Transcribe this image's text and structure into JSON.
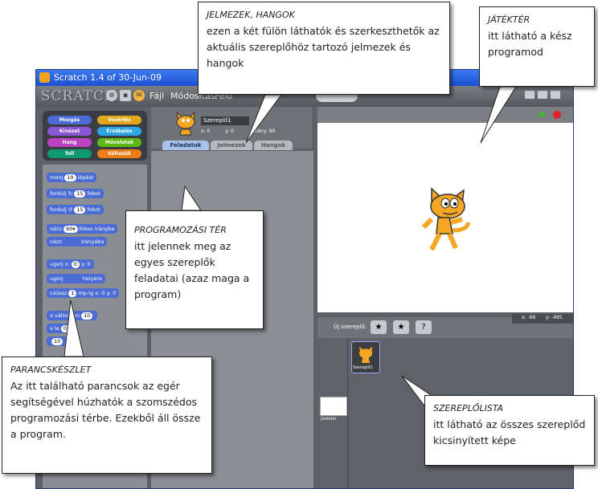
{
  "window": {
    "title": "Scratch 1.4 of 30-Jun-09",
    "logo_text": "SCRATCH",
    "menu": [
      "Fájl",
      "Módosítás",
      "Felo"
    ]
  },
  "categories": [
    {
      "label": "Mozgás",
      "color": "#4a6cd4"
    },
    {
      "label": "Vezérlés",
      "color": "#e1a91a"
    },
    {
      "label": "Kinézet",
      "color": "#8a55d7"
    },
    {
      "label": "Érzékelés",
      "color": "#2ca5e2"
    },
    {
      "label": "Hang",
      "color": "#bb42c3"
    },
    {
      "label": "Műveletek",
      "color": "#5cb712"
    },
    {
      "label": "Toll",
      "color": "#0e9a6c"
    },
    {
      "label": "Változók",
      "color": "#ee7d16"
    }
  ],
  "blocks": [
    {
      "pre": "menj",
      "val": "10",
      "post": "lépést"
    },
    {
      "pre": "fordulj ↻",
      "val": "15",
      "post": "fokot"
    },
    {
      "pre": "fordulj ↺",
      "val": "15",
      "post": "fokot"
    },
    {
      "pre": "nézz",
      "val": "90▾",
      "post": "fokos irányba"
    },
    {
      "pre": "nézz",
      "val": " ",
      "post": "irányába"
    },
    {
      "pre": "ugorj x:",
      "val": "0",
      "post": "y: 0"
    },
    {
      "pre": "ugorj",
      "val": " ",
      "post": "helyére"
    },
    {
      "pre": "csússz",
      "val": "1",
      "post": "mp-ig x: 0 y: 0"
    },
    {
      "pre": "x változzon",
      "val": "10",
      "post": ""
    },
    {
      "pre": "x le",
      "val": "0",
      "post": ""
    },
    {
      "pre": "",
      "val": "10",
      "post": ""
    }
  ],
  "sprite": {
    "name": "Szereplő1",
    "x_label": "x: 0",
    "y_label": "y: 0",
    "dir_label": "irány: 90"
  },
  "tabs": [
    "Feladatok",
    "Jelmezek",
    "Hangok"
  ],
  "stage": {
    "coords_x": "x: -66",
    "coords_y": "y: -495",
    "new_sprite_label": "Új szereplő:",
    "stage_thumb_label": "Játéktér"
  },
  "callouts": {
    "jelmezek": {
      "title": "JELMEZEK, HANGOK",
      "text": "ezen a két fülön láthatók és szerkeszthetők az aktuális szereplőhöz tartozó jelmezek és hangok"
    },
    "jatekter": {
      "title": "JÁTÉKTÉR",
      "text": "itt látható a kész programod"
    },
    "programozasi": {
      "title": "PROGRAMOZÁSI TÉR",
      "text": "itt jelennek meg az egyes szereplők feladatai (azaz maga a program)"
    },
    "parancskeszlet": {
      "title": "PARANCSKÉSZLET",
      "text": "Az itt található parancsok az egér segítségével húzhatók a szomszédos programozási térbe. Ezekből áll össze a program."
    },
    "szereplolista": {
      "title": "SZEREPLŐLISTA",
      "text": "itt látható az összes szereplőd kicsinyített képe"
    }
  }
}
